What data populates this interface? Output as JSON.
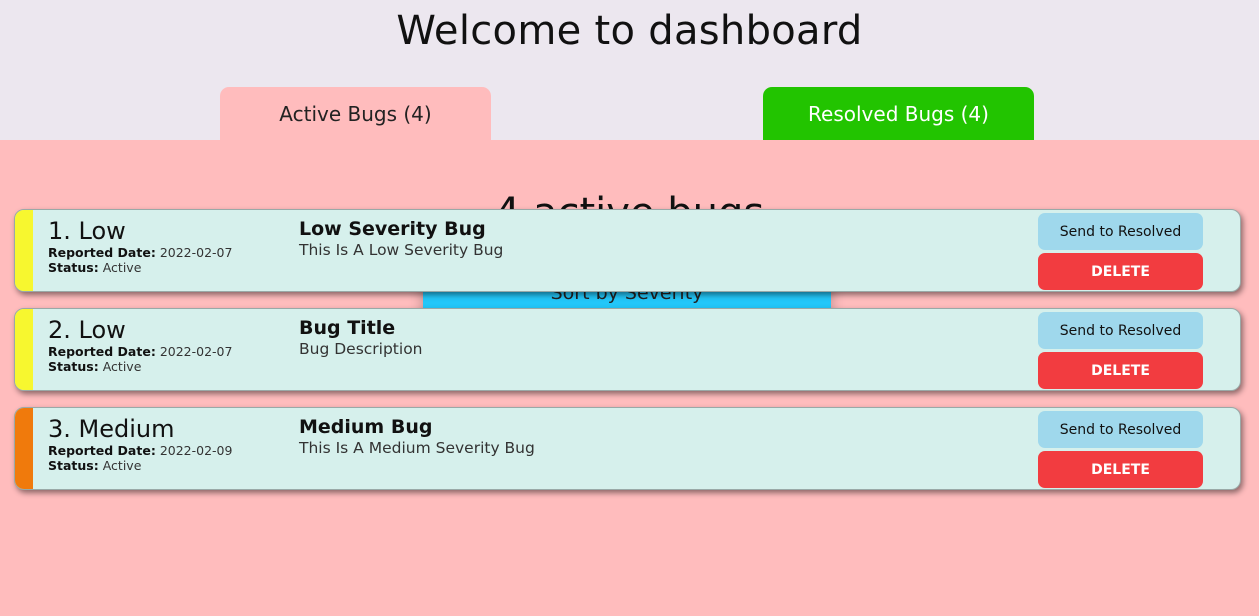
{
  "page": {
    "title": "Welcome to dashboard"
  },
  "tabs": {
    "active": "Active Bugs (4)",
    "resolved": "Resolved Bugs (4)"
  },
  "panel": {
    "heading": "4 active bugs",
    "sort_label": "Sort by Severity"
  },
  "labels": {
    "reported_date": "Reported Date:",
    "status": "Status:",
    "resolve_button": "Send to Resolved",
    "delete_button": "DELETE"
  },
  "colors": {
    "background": "#ece7ef",
    "active_panel": "#ffbcbd",
    "resolved_tab": "#22c400",
    "sort_button": "#23c7f9",
    "card": "#d6f0ec",
    "resolve_button": "#9fd8ec",
    "delete_button": "#f23c40",
    "severity_low": "#f7f72f",
    "severity_medium": "#f07a0c"
  },
  "bugs": [
    {
      "heading": "1. Low",
      "severity_color": "#f7f72f",
      "reported_date": "2022-02-07",
      "status": "Active",
      "title": "Low Severity Bug",
      "description": "This Is A Low Severity Bug"
    },
    {
      "heading": "2. Low",
      "severity_color": "#f7f72f",
      "reported_date": "2022-02-07",
      "status": "Active",
      "title": "Bug Title",
      "description": "Bug Description"
    },
    {
      "heading": "3. Medium",
      "severity_color": "#f07a0c",
      "reported_date": "2022-02-09",
      "status": "Active",
      "title": "Medium Bug",
      "description": "This Is A Medium Severity Bug"
    }
  ]
}
